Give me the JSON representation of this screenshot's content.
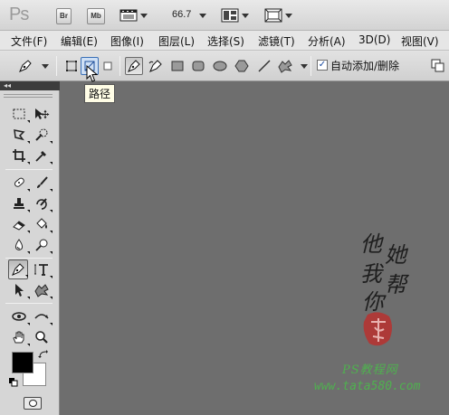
{
  "app": {
    "logo": "Ps",
    "bridge_label": "Br",
    "minibridge_label": "Mb",
    "zoom": "66.7"
  },
  "menu": [
    "文件(F)",
    "编辑(E)",
    "图像(I)",
    "图层(L)",
    "选择(S)",
    "滤镜(T)",
    "分析(A)",
    "3D(D)",
    "视图(V)"
  ],
  "options": {
    "auto_add_delete_label": "自动添加/删除",
    "auto_add_delete_checked": true
  },
  "tooltip": {
    "text": "路径"
  },
  "toolbox": {
    "header": "◂◂"
  },
  "colors": {
    "foreground": "#000000",
    "background": "#ffffff"
  },
  "watermark": {
    "calligraphy": [
      "他",
      "她",
      "我",
      "帮",
      "你"
    ],
    "ps_line": "PS教程网",
    "url": "www.tata580.com"
  }
}
